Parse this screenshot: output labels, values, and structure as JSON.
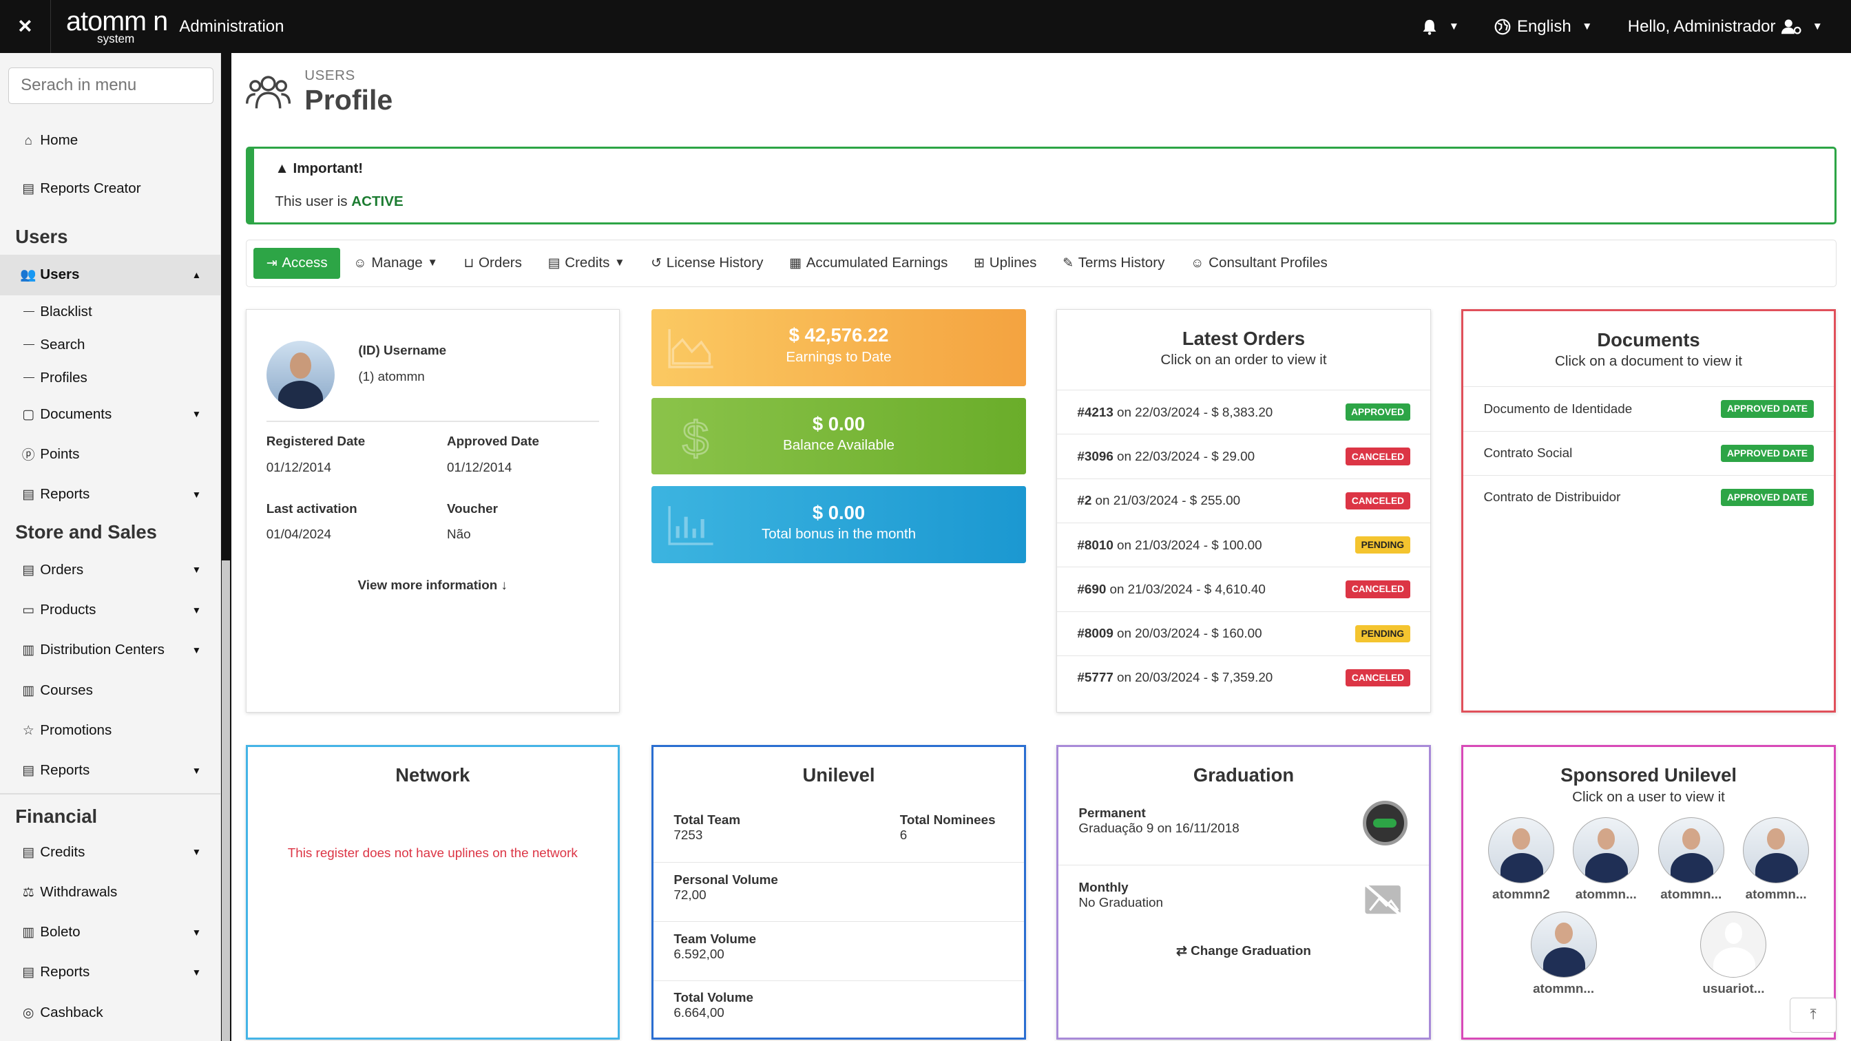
{
  "topbar": {
    "close": "×",
    "logo_main": "atomm n",
    "logo_sub": "system",
    "title": "Administration",
    "language": "English",
    "greeting": "Hello, Administrador"
  },
  "sidebar": {
    "search_placeholder": "Serach in menu",
    "top": [
      {
        "label": "Home",
        "icon": "home-icon"
      },
      {
        "label": "Reports Creator",
        "icon": "report-icon"
      }
    ],
    "users_head": "Users",
    "users_item": "Users",
    "users_subs": [
      "Blacklist",
      "Search",
      "Profiles"
    ],
    "users_more": [
      "Documents",
      "Points",
      "Reports"
    ],
    "store_head": "Store and Sales",
    "store_items": [
      "Orders",
      "Products",
      "Distribution Centers",
      "Courses",
      "Promotions",
      "Reports"
    ],
    "financial_head": "Financial",
    "financial_items": [
      "Credits",
      "Withdrawals",
      "Boleto",
      "Reports",
      "Cashback"
    ]
  },
  "page": {
    "section": "USERS",
    "title": "Profile"
  },
  "alert": {
    "title": "Important!",
    "body_prefix": "This user is ",
    "status": "ACTIVE"
  },
  "tabs": [
    "Access",
    "Manage",
    "Orders",
    "Credits",
    "License History",
    "Accumulated Earnings",
    "Uplines",
    "Terms History",
    "Consultant Profiles"
  ],
  "user": {
    "id_label": "(ID) Username",
    "id_value": "(1) atommn",
    "registered_label": "Registered Date",
    "registered_value": "01/12/2014",
    "approved_label": "Approved Date",
    "approved_value": "01/12/2014",
    "last_label": "Last activation",
    "last_value": "01/04/2024",
    "voucher_label": "Voucher",
    "voucher_value": "Não",
    "more": "View more information"
  },
  "stats": [
    {
      "value": "$ 42,576.22",
      "label": "Earnings to Date",
      "color": "#f4a340"
    },
    {
      "value": "$ 0.00",
      "label": "Balance Available",
      "color": "#6aad2a"
    },
    {
      "value": "$ 0.00",
      "label": "Total bonus in the month",
      "color": "#1b98d1"
    }
  ],
  "orders": {
    "title": "Latest Orders",
    "subtitle": "Click on an order to view it",
    "items": [
      {
        "id": "#4213",
        "text": "on 22/03/2024 - $ 8,383.20",
        "status": "APPROVED",
        "kind": "green"
      },
      {
        "id": "#3096",
        "text": "on 22/03/2024 - $ 29.00",
        "status": "CANCELED",
        "kind": "red"
      },
      {
        "id": "#2",
        "text": "on 21/03/2024 - $ 255.00",
        "status": "CANCELED",
        "kind": "red"
      },
      {
        "id": "#8010",
        "text": "on 21/03/2024 - $ 100.00",
        "status": "PENDING",
        "kind": "yellow"
      },
      {
        "id": "#690",
        "text": "on 21/03/2024 - $ 4,610.40",
        "status": "CANCELED",
        "kind": "red"
      },
      {
        "id": "#8009",
        "text": "on 20/03/2024 - $ 160.00",
        "status": "PENDING",
        "kind": "yellow"
      },
      {
        "id": "#5777",
        "text": "on 20/03/2024 - $ 7,359.20",
        "status": "CANCELED",
        "kind": "red"
      }
    ]
  },
  "documents": {
    "title": "Documents",
    "subtitle": "Click on a document to view it",
    "items": [
      {
        "name": "Documento de Identidade",
        "status": "APPROVED DATE"
      },
      {
        "name": "Contrato Social",
        "status": "APPROVED DATE"
      },
      {
        "name": "Contrato de Distribuidor",
        "status": "APPROVED DATE"
      }
    ]
  },
  "network": {
    "title": "Network",
    "message": "This register does not have uplines on the network"
  },
  "unilevel": {
    "title": "Unilevel",
    "team_label": "Total Team",
    "team_value": "7253",
    "nominees_label": "Total Nominees",
    "nominees_value": "6",
    "pv_label": "Personal Volume",
    "pv_value": "72,00",
    "tv_label": "Team Volume",
    "tv_value": "6.592,00",
    "total_label": "Total Volume",
    "total_value": "6.664,00"
  },
  "graduation": {
    "title": "Graduation",
    "perm_label": "Permanent",
    "perm_value": "Graduação 9 on 16/11/2018",
    "monthly_label": "Monthly",
    "monthly_value": "No Graduation",
    "change": "Change Graduation"
  },
  "sponsored": {
    "title": "Sponsored Unilevel",
    "subtitle": "Click on a user to view it",
    "users": [
      "atommn2",
      "atommn...",
      "atommn...",
      "atommn...",
      "atommn...",
      "usuariot..."
    ]
  }
}
